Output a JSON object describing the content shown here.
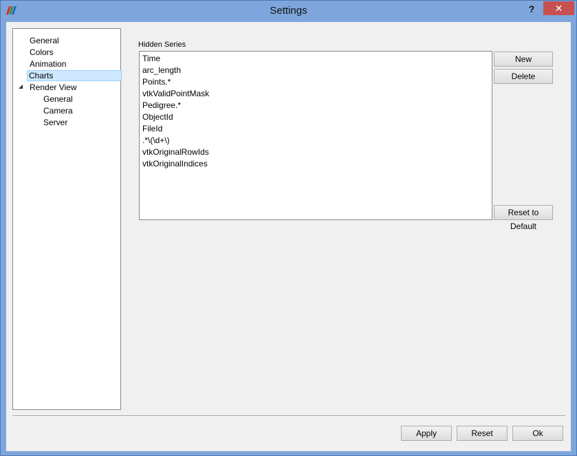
{
  "window": {
    "title": "Settings",
    "help_label": "?",
    "close_label": "✕"
  },
  "tree": {
    "items": [
      {
        "label": "General"
      },
      {
        "label": "Colors"
      },
      {
        "label": "Animation"
      },
      {
        "label": "Charts"
      },
      {
        "label": "Render View"
      },
      {
        "label": "General"
      },
      {
        "label": "Camera"
      },
      {
        "label": "Server"
      }
    ],
    "expander": "◢",
    "selected": "Charts"
  },
  "hidden_series": {
    "label": "Hidden Series",
    "items": [
      "Time",
      "arc_length",
      "Points.*",
      "vtkValidPointMask",
      "Pedigree.*",
      "ObjectId",
      "FileId",
      ".*\\(\\d+\\)",
      "vtkOriginalRowIds",
      "vtkOriginalIndices"
    ]
  },
  "buttons": {
    "new": "New",
    "delete": "Delete",
    "reset_default": "Reset to Default",
    "apply": "Apply",
    "reset": "Reset",
    "ok": "Ok"
  },
  "icons": {
    "app": "paraview-logo-icon",
    "help": "help-icon",
    "close": "close-icon"
  }
}
